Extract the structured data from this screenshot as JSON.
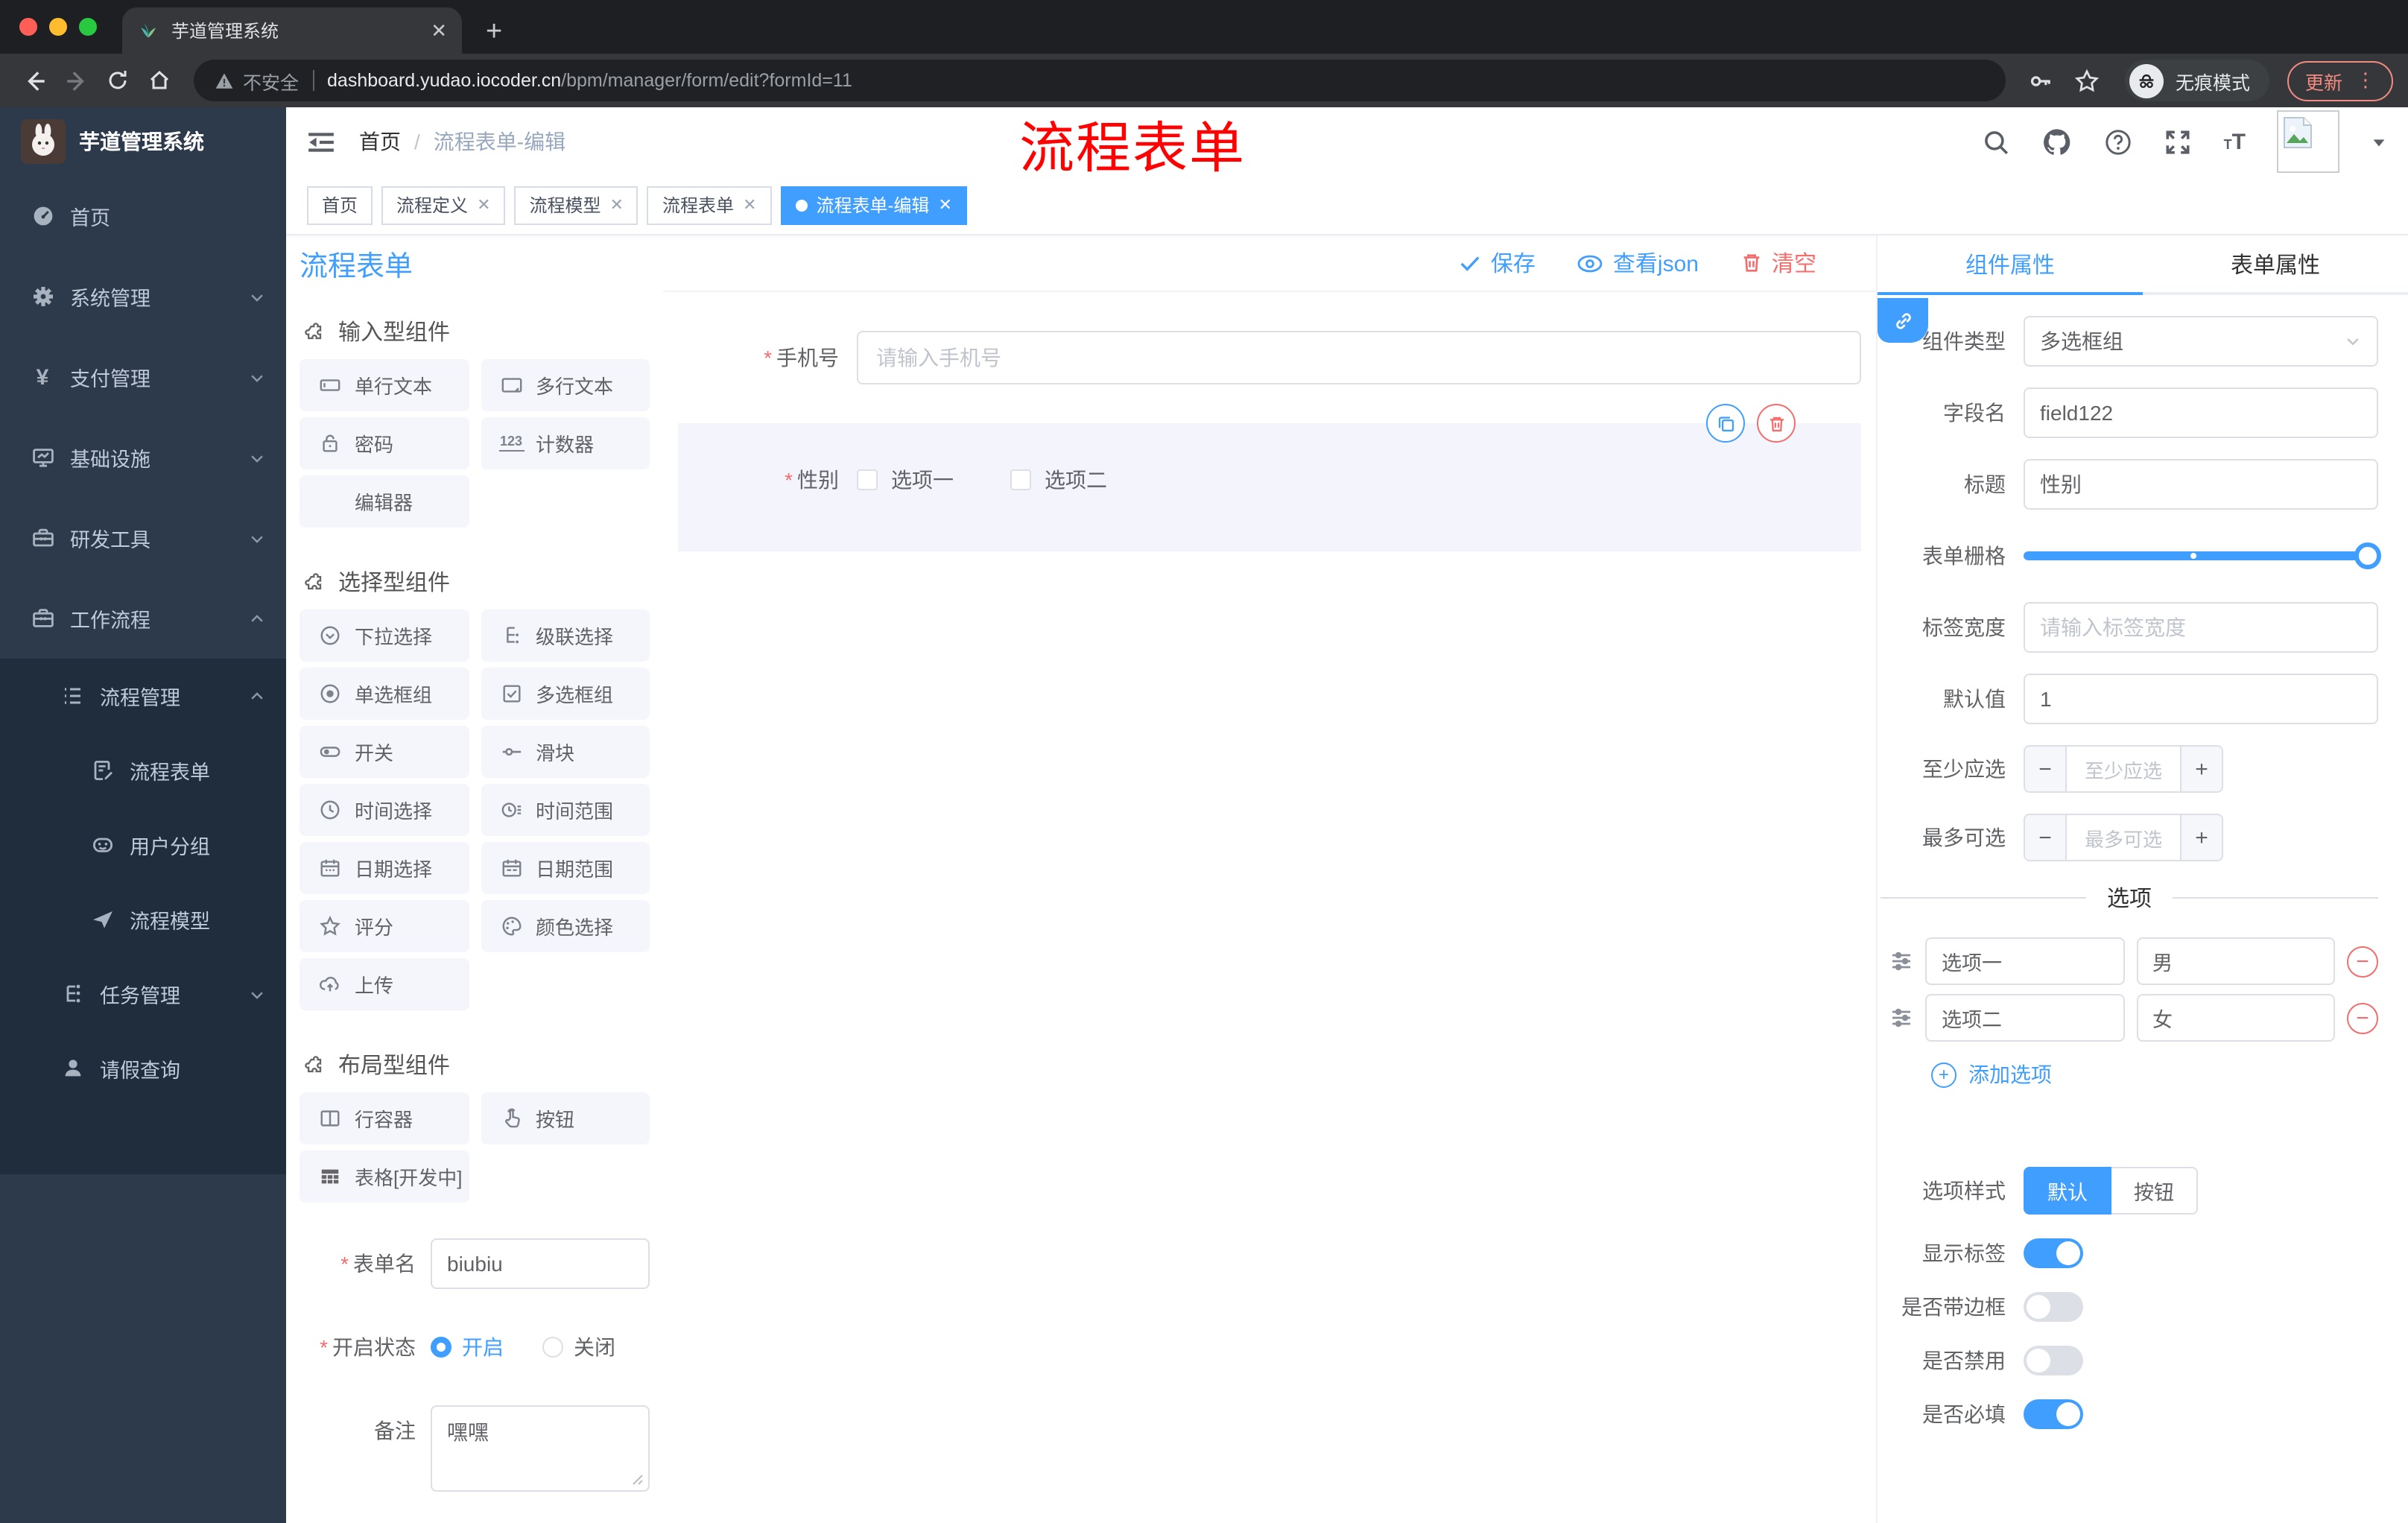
{
  "browser": {
    "tab_title": "芋道管理系统",
    "security_label": "不安全",
    "url_host": "dashboard.yudao.iocoder.cn",
    "url_path": "/bpm/manager/form/edit?formId=11",
    "incognito_label": "无痕模式",
    "update_label": "更新"
  },
  "app": {
    "logo_title": "芋道管理系统",
    "breadcrumb_home": "首页",
    "breadcrumb_current": "流程表单-编辑",
    "annotation": "流程表单"
  },
  "sidebar": {
    "items": [
      {
        "label": "首页"
      },
      {
        "label": "系统管理"
      },
      {
        "label": "支付管理"
      },
      {
        "label": "基础设施"
      },
      {
        "label": "研发工具"
      },
      {
        "label": "工作流程"
      },
      {
        "label": "流程管理"
      },
      {
        "label": "流程表单"
      },
      {
        "label": "用户分组"
      },
      {
        "label": "流程模型"
      },
      {
        "label": "任务管理"
      },
      {
        "label": "请假查询"
      }
    ]
  },
  "tags": {
    "items": [
      {
        "label": "首页"
      },
      {
        "label": "流程定义"
      },
      {
        "label": "流程模型"
      },
      {
        "label": "流程表单"
      },
      {
        "label": "流程表单-编辑"
      }
    ]
  },
  "designer": {
    "title": "流程表单",
    "actions": {
      "save": "保存",
      "view_json": "查看json",
      "clear": "清空"
    },
    "sections": {
      "input": {
        "title": "输入型组件",
        "items": [
          "单行文本",
          "多行文本",
          "密码",
          "计数器",
          "编辑器"
        ]
      },
      "select": {
        "title": "选择型组件",
        "items": [
          "下拉选择",
          "级联选择",
          "单选框组",
          "多选框组",
          "开关",
          "滑块",
          "时间选择",
          "时间范围",
          "日期选择",
          "日期范围",
          "评分",
          "颜色选择",
          "上传"
        ]
      },
      "layout": {
        "title": "布局型组件",
        "items": [
          "行容器",
          "按钮",
          "表格[开发中]"
        ]
      }
    },
    "meta_form": {
      "name_label": "表单名",
      "name_value": "biubiu",
      "status_label": "开启状态",
      "status_on": "开启",
      "status_off": "关闭",
      "remark_label": "备注",
      "remark_value": "嘿嘿"
    },
    "canvas": {
      "phone_label": "手机号",
      "phone_placeholder": "请输入手机号",
      "gender_label": "性别",
      "option1": "选项一",
      "option2": "选项二"
    }
  },
  "props": {
    "tab_component": "组件属性",
    "tab_form": "表单属性",
    "rows": {
      "type_label": "组件类型",
      "type_value": "多选框组",
      "field_label": "字段名",
      "field_value": "field122",
      "title_label": "标题",
      "title_value": "性别",
      "grid_label": "表单栅格",
      "width_label": "标签宽度",
      "width_placeholder": "请输入标签宽度",
      "default_label": "默认值",
      "default_value": "1",
      "min_label": "至少应选",
      "min_placeholder": "至少应选",
      "max_label": "最多可选",
      "max_placeholder": "最多可选"
    },
    "options": {
      "divider": "选项",
      "rows": [
        {
          "label": "选项一",
          "value": "男"
        },
        {
          "label": "选项二",
          "value": "女"
        }
      ],
      "add": "添加选项"
    },
    "style": {
      "label": "选项样式",
      "default": "默认",
      "button": "按钮"
    },
    "switches": [
      {
        "label": "显示标签",
        "on": true
      },
      {
        "label": "是否带边框",
        "on": false
      },
      {
        "label": "是否禁用",
        "on": false
      },
      {
        "label": "是否必填",
        "on": true
      }
    ]
  },
  "colors": {
    "primary": "#409eff",
    "danger": "#f56c6c",
    "annotation": "#fe0100",
    "sidebar_bg": "#2d3a4b",
    "submenu_bg": "#1f2d3d"
  }
}
